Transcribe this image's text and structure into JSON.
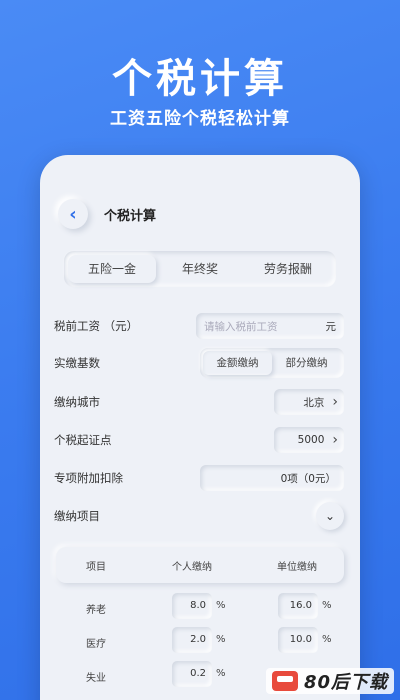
{
  "hero": {
    "title": "个税计算",
    "subtitle": "工资五险个税轻松计算"
  },
  "topbar": {
    "title": "个税计算"
  },
  "tabs": [
    "五险一金",
    "年终奖",
    "劳务报酬"
  ],
  "form": {
    "salary": {
      "label": "税前工资 （元）",
      "placeholder": "请输入税前工资",
      "unit": "元"
    },
    "base": {
      "label": "实缴基数",
      "options": [
        "金额缴纳",
        "部分缴纳"
      ]
    },
    "city": {
      "label": "缴纳城市",
      "value": "北京"
    },
    "threshold": {
      "label": "个税起证点",
      "value": "5000"
    },
    "deduction": {
      "label": "专项附加扣除",
      "value": "0项（0元）"
    },
    "items": {
      "label": "缴纳项目"
    }
  },
  "table": {
    "headers": [
      "项目",
      "个人缴纳",
      "单位缴纳"
    ],
    "rows": [
      {
        "name": "养老",
        "personal": "8.0",
        "company": "16.0",
        "unit": "%"
      },
      {
        "name": "医疗",
        "personal": "2.0",
        "company": "10.0",
        "unit": "%"
      },
      {
        "name": "失业",
        "personal": "0.2",
        "company": "",
        "unit": "%"
      }
    ]
  },
  "watermark": {
    "text": "80后下载"
  },
  "colors": {
    "brand": "#3a7bef",
    "surface": "#eef1f7"
  }
}
